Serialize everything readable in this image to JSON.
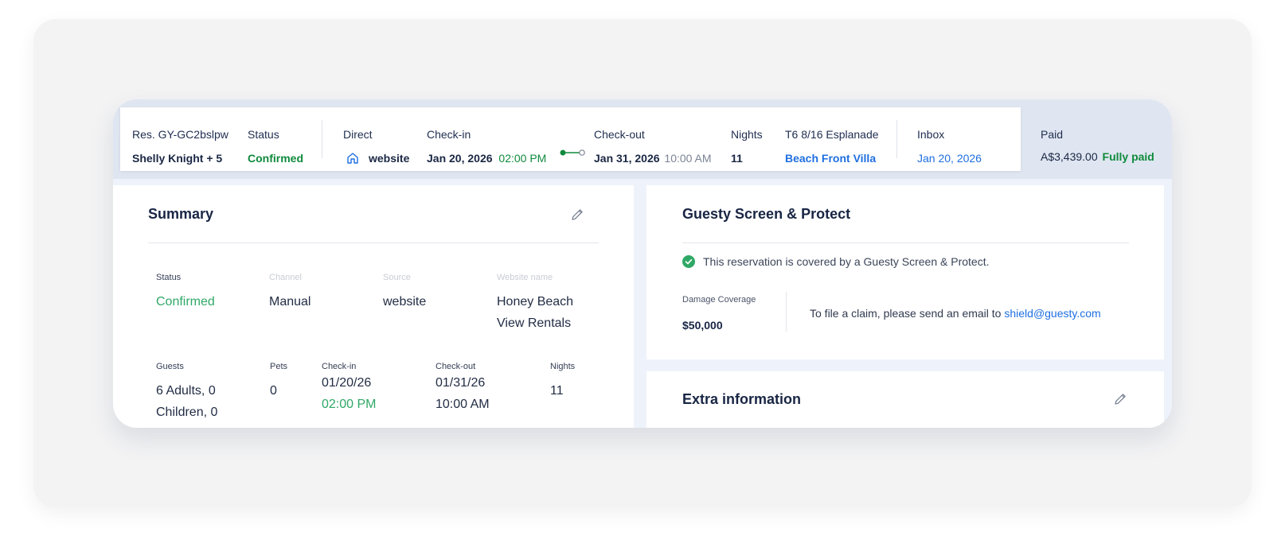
{
  "header": {
    "reservation": {
      "label": "Res. GY-GC2bslpw",
      "value": "Shelly Knight + 5"
    },
    "status": {
      "label": "Status",
      "value": "Confirmed"
    },
    "channel": {
      "label": "Direct",
      "value": "website"
    },
    "checkin": {
      "label": "Check-in",
      "date": "Jan 20, 2026",
      "time": "02:00 PM"
    },
    "checkout": {
      "label": "Check-out",
      "date": "Jan 31, 2026",
      "time": "10:00 AM"
    },
    "nights": {
      "label": "Nights",
      "value": "11"
    },
    "listing": {
      "label": "T6 8/16 Esplanade",
      "value": "Beach Front Villa"
    },
    "inbox": {
      "label": "Inbox",
      "value": "Jan 20, 2026"
    },
    "payment": {
      "label": "Paid",
      "amount": "A$3,439.00",
      "status": "Fully paid"
    }
  },
  "summary": {
    "title": "Summary",
    "status_label": "Status",
    "status_value": "Confirmed",
    "channel_label": "Channel",
    "channel_value": "Manual",
    "source_label": "Source",
    "source_value": "website",
    "website_label": "Website name",
    "website_value_1": "Honey Beach",
    "website_value_2": "View Rentals",
    "guests_label": "Guests",
    "guests_value_1": "6 Adults, 0",
    "guests_value_2": "Children, 0",
    "pets_label": "Pets",
    "pets_value": "0",
    "checkin_label": "Check-in",
    "checkin_date": "01/20/26",
    "checkin_time": "02:00 PM",
    "checkout_label": "Check-out",
    "checkout_date": "01/31/26",
    "checkout_time": "10:00 AM",
    "nights_label": "Nights",
    "nights_value": "11"
  },
  "protect": {
    "title": "Guesty Screen & Protect",
    "covered_text": "This reservation is covered by a Guesty Screen & Protect.",
    "damage_label": "Damage Coverage",
    "damage_value": "$50,000",
    "claim_text": "To file a claim, please send an email to ",
    "claim_email": "shield@guesty.com"
  },
  "extra": {
    "title": "Extra information"
  },
  "colors": {
    "green": "#0f8a3c",
    "blue": "#1f6fe0",
    "navy": "#182544",
    "check_green": "#2fa866"
  },
  "icons": [
    "house-icon",
    "timeline-icon",
    "pencil-icon",
    "check-circle-icon"
  ]
}
